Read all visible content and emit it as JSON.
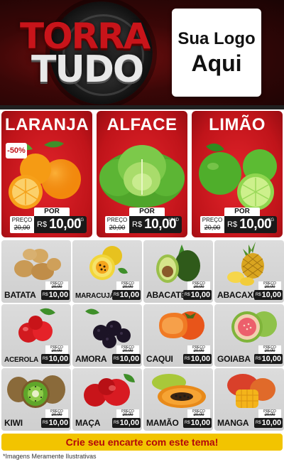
{
  "brand": {
    "line1": "TORRA",
    "line2": "TUDO"
  },
  "logo_placeholder": {
    "line1": "Sua Logo",
    "line2": "Aqui"
  },
  "colors": {
    "header_red": "#c8141a",
    "card_red": "#c0141a",
    "price_dark": "#1a1a1a",
    "cta_yellow": "#f2c400",
    "cta_text": "#b3070b"
  },
  "highlights": [
    {
      "name": "LARANJA",
      "discount": "-50%",
      "por": "POR",
      "preco": "PREÇO",
      "old": "20,00",
      "currency": "R$",
      "price": "10,00",
      "unit": "KG",
      "icon": "orange-icon"
    },
    {
      "name": "ALFACE",
      "por": "POR",
      "preco": "PREÇO",
      "old": "20,00",
      "currency": "R$",
      "price": "10,00",
      "unit": "UNID",
      "icon": "lettuce-icon"
    },
    {
      "name": "LIMÃO",
      "por": "POR",
      "preco": "PREÇO",
      "old": "20,00",
      "currency": "R$",
      "price": "10,00",
      "unit": "KG",
      "icon": "lime-icon"
    }
  ],
  "products": [
    {
      "name": "BATATA",
      "preco": "PREÇO",
      "old": "20,00",
      "por": "POR",
      "currency": "R$",
      "price": "10,00",
      "icon": "potato-icon"
    },
    {
      "name": "MARACUJÁ",
      "preco": "PREÇO",
      "old": "20,00",
      "por": "POR",
      "currency": "R$",
      "price": "10,00",
      "icon": "passion-fruit-icon"
    },
    {
      "name": "ABACATE",
      "preco": "PREÇO",
      "old": "20,00",
      "por": "POR",
      "currency": "R$",
      "price": "10,00",
      "icon": "avocado-icon"
    },
    {
      "name": "ABACAXI",
      "preco": "PREÇO",
      "old": "20,00",
      "por": "POR",
      "currency": "R$",
      "price": "10,00",
      "icon": "pineapple-icon"
    },
    {
      "name": "ACEROLA",
      "preco": "PREÇO",
      "old": "20,00",
      "por": "POR",
      "currency": "R$",
      "price": "10,00",
      "icon": "acerola-icon"
    },
    {
      "name": "AMORA",
      "preco": "PREÇO",
      "old": "20,00",
      "por": "POR",
      "currency": "R$",
      "price": "10,00",
      "icon": "blackberry-icon"
    },
    {
      "name": "CAQUI",
      "preco": "PREÇO",
      "old": "20,00",
      "por": "POR",
      "currency": "R$",
      "price": "10,00",
      "icon": "persimmon-icon"
    },
    {
      "name": "GOIABA",
      "preco": "PREÇO",
      "old": "20,00",
      "por": "POR",
      "currency": "R$",
      "price": "10,00",
      "icon": "guava-icon"
    },
    {
      "name": "KIWI",
      "preco": "PREÇO",
      "old": "20,00",
      "por": "POR",
      "currency": "R$",
      "price": "10,00",
      "icon": "kiwi-icon"
    },
    {
      "name": "MAÇA",
      "preco": "PREÇO",
      "old": "20,00",
      "por": "POR",
      "currency": "R$",
      "price": "10,00",
      "icon": "apple-icon"
    },
    {
      "name": "MAMÃO",
      "preco": "PREÇO",
      "old": "20,00",
      "por": "POR",
      "currency": "R$",
      "price": "10,00",
      "icon": "papaya-icon"
    },
    {
      "name": "MANGA",
      "preco": "PREÇO",
      "old": "20,00",
      "por": "POR",
      "currency": "R$",
      "price": "10,00",
      "icon": "mango-icon"
    }
  ],
  "cta": "Crie seu encarte com este tema!",
  "disclaimer": "*Imagens Meramente Ilustrativas"
}
